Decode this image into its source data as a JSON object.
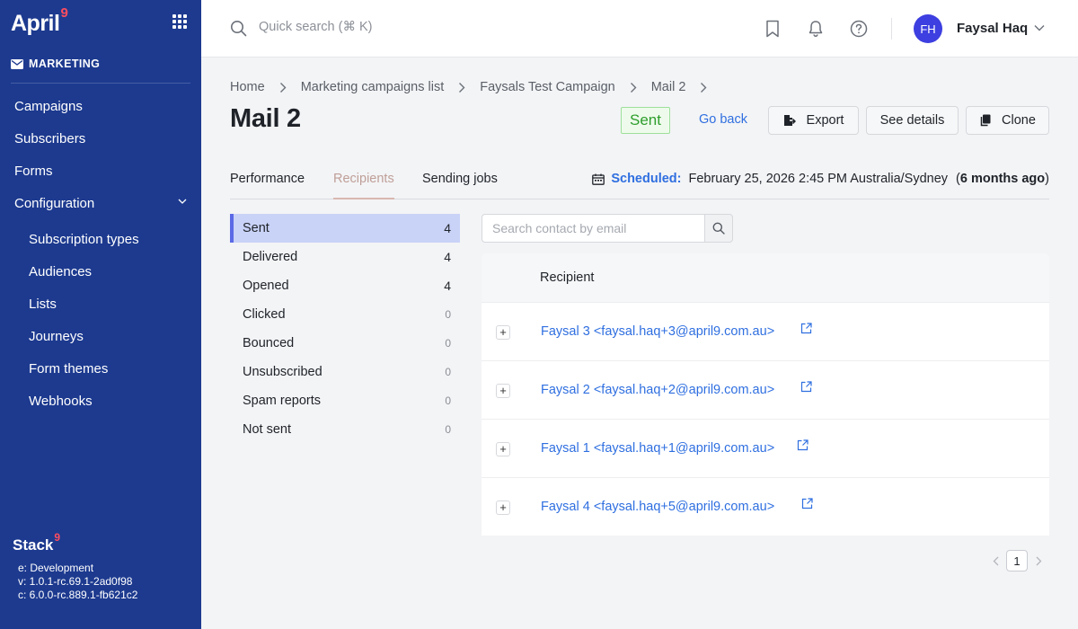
{
  "app": {
    "brand": "April",
    "brand_sup": "9",
    "section": "MARKETING"
  },
  "sidebar": {
    "items": [
      {
        "label": "Campaigns"
      },
      {
        "label": "Subscribers"
      },
      {
        "label": "Forms"
      },
      {
        "label": "Configuration"
      },
      {
        "label": "Subscription types"
      },
      {
        "label": "Audiences"
      },
      {
        "label": "Lists"
      },
      {
        "label": "Journeys"
      },
      {
        "label": "Form themes"
      },
      {
        "label": "Webhooks"
      }
    ],
    "footer": {
      "brand": "Stack",
      "brand_sup": "9",
      "env": "e: Development",
      "version": "v: 1.0.1-rc.69.1-2ad0f98",
      "core": "c: 6.0.0-rc.889.1-fb621c2"
    }
  },
  "topbar": {
    "search_placeholder": "Quick search (⌘ K)",
    "user_initials": "FH",
    "user_name": "Faysal Haq"
  },
  "breadcrumb": [
    "Home",
    "Marketing campaigns list",
    "Faysals Test Campaign",
    "Mail 2"
  ],
  "page": {
    "title": "Mail 2",
    "status": "Sent",
    "go_back": "Go back",
    "export": "Export",
    "see_details": "See details",
    "clone": "Clone"
  },
  "tabs": [
    {
      "label": "Performance"
    },
    {
      "label": "Recipients"
    },
    {
      "label": "Sending jobs"
    }
  ],
  "scheduled": {
    "label": "Scheduled:",
    "value": "February 25, 2026 2:45 PM Australia/Sydney",
    "relative_open": "(",
    "relative": "6 months ago",
    "relative_close": ")"
  },
  "stats": [
    {
      "label": "Sent",
      "count": "4"
    },
    {
      "label": "Delivered",
      "count": "4"
    },
    {
      "label": "Opened",
      "count": "4"
    },
    {
      "label": "Clicked",
      "count": "0"
    },
    {
      "label": "Bounced",
      "count": "0"
    },
    {
      "label": "Unsubscribed",
      "count": "0"
    },
    {
      "label": "Spam reports",
      "count": "0"
    },
    {
      "label": "Not sent",
      "count": "0"
    }
  ],
  "contact_search": {
    "placeholder": "Search contact by email"
  },
  "table": {
    "header": "Recipient",
    "rows": [
      {
        "expand": "+",
        "recipient": "Faysal 3 <faysal.haq+3@april9.com.au>"
      },
      {
        "expand": "+",
        "recipient": "Faysal 2 <faysal.haq+2@april9.com.au>"
      },
      {
        "expand": "+",
        "recipient": "Faysal 1 <faysal.haq+1@april9.com.au>"
      },
      {
        "expand": "+",
        "recipient": "Faysal 4 <faysal.haq+5@april9.com.au>"
      }
    ]
  },
  "pagination": {
    "current": "1"
  },
  "icons": {
    "grid": "apps-grid-icon",
    "mail": "envelope-icon",
    "search": "search-icon",
    "bookmark": "bookmark-icon",
    "bell": "bell-icon",
    "help": "help-circle-icon",
    "calendar": "calendar-icon",
    "external": "external-link-icon"
  },
  "colors": {
    "sidebar": "#1d3a8f",
    "accent": "#2f6fe0",
    "brand_sup": "#ff4d5e",
    "sent_green": "#2e9e2c",
    "avatar": "#3d3fe0"
  }
}
